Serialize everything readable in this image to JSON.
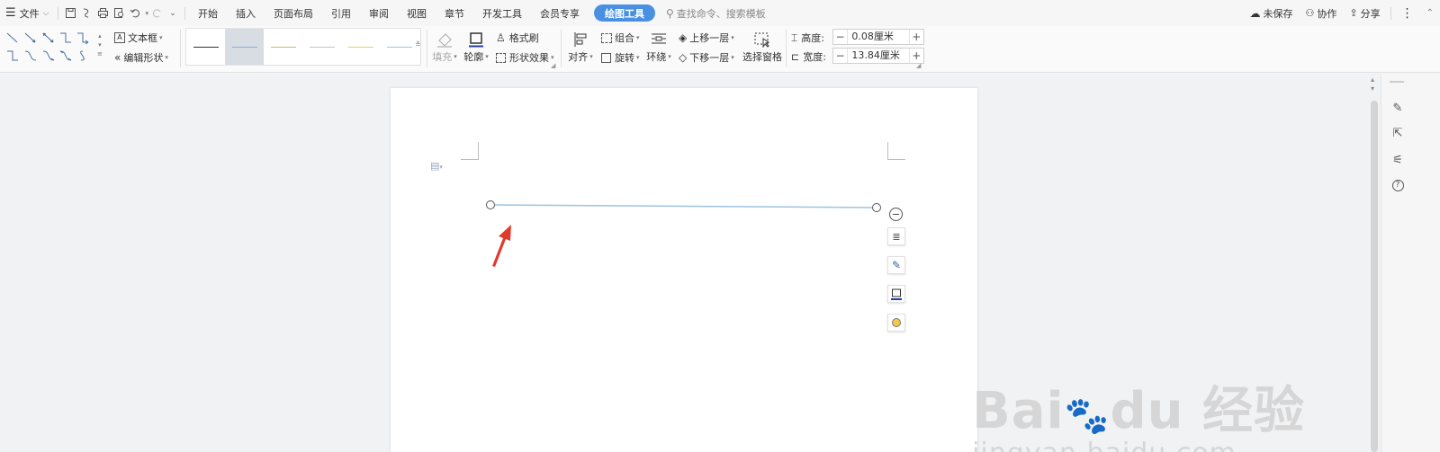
{
  "menubar": {
    "file_label": "文件",
    "tabs": [
      {
        "label": "开始"
      },
      {
        "label": "插入"
      },
      {
        "label": "页面布局"
      },
      {
        "label": "引用"
      },
      {
        "label": "审阅"
      },
      {
        "label": "视图"
      },
      {
        "label": "章节"
      },
      {
        "label": "开发工具"
      },
      {
        "label": "会员专享"
      },
      {
        "label": "绘图工具"
      }
    ],
    "active_tab": "绘图工具",
    "search_placeholder": "查找命令、搜索模板",
    "right": {
      "unsaved": "未保存",
      "collab": "协作",
      "share": "分享"
    }
  },
  "ribbon": {
    "textbox": "文本框",
    "edit_shape": "编辑形状",
    "fill": "填充",
    "outline": "轮廓",
    "format_painter": "格式刷",
    "shape_effects": "形状效果",
    "align": "对齐",
    "group": "组合",
    "rotate": "旋转",
    "wrap": "环绕",
    "bring_forward": "上移一层",
    "send_backward": "下移一层",
    "selection_pane": "选择窗格",
    "height_label": "高度:",
    "height_value": "0.08厘米",
    "width_label": "宽度:",
    "width_value": "13.84厘米",
    "line_style_colors": [
      "#333333",
      "#7fb2e5",
      "#d8b26a",
      "#c6c6c6",
      "#e3d75a",
      "#9fc3e8"
    ]
  },
  "watermark": {
    "brand": "Bai",
    "brand2": "du",
    "brand_cn": "经验",
    "url": "jingyan.baidu.com"
  },
  "colors": {
    "accent": "#4a90e2",
    "line": "#9cc3e0",
    "arrow": "#e03a2f"
  }
}
